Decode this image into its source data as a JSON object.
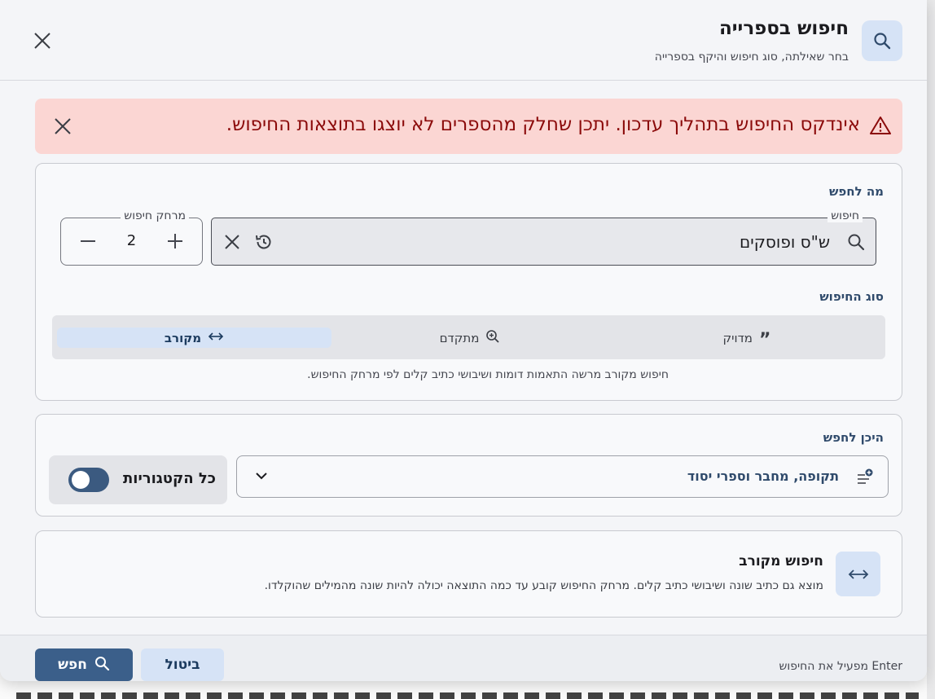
{
  "dialog": {
    "title": "חיפוש בספרייה",
    "subtitle": "בחר שאילתה, סוג חיפוש והיקף בספרייה"
  },
  "alert": {
    "text": "אינדקס החיפוש בתהליך עדכון. יתכן שחלק מהספרים לא יוצגו בתוצאות החיפוש."
  },
  "what": {
    "section_title": "מה לחפש",
    "search_label": "חיפוש",
    "search_value": "ש\"ס ופוסקים",
    "distance_label": "מרחק חיפוש",
    "distance_value": "2"
  },
  "search_type": {
    "section_title": "סוג החיפוש",
    "options": [
      {
        "label": "מדויק",
        "icon": "quote-icon"
      },
      {
        "label": "מתקדם",
        "icon": "zoom-in-icon"
      },
      {
        "label": "מקורב",
        "icon": "arrows-horizontal-icon",
        "selected": true
      }
    ],
    "note": "חיפוש מקורב מרשה התאמות דומות ושיבושי כתיב קלים לפי מרחק החיפוש."
  },
  "where": {
    "section_title": "היכן לחפש",
    "scope_label": "תקופה, מחבר וספרי יסוד",
    "categories_label": "כל הקטגוריות",
    "categories_toggle": false
  },
  "mode_info": {
    "title": "חיפוש מקורב",
    "description": "מוצא גם כתיב שונה ושיבושי כתיב קלים. מרחק החיפוש קובע עד כמה התוצאה יכולה להיות שונה מהמילים שהוקלדו."
  },
  "footer": {
    "hint": "Enter מפעיל את החיפוש",
    "cancel_label": "ביטול",
    "search_label": "חפש"
  },
  "colors": {
    "accent": "#3b5f8a",
    "accent_light": "#d6e3f6",
    "alert_bg": "#fbd6d3",
    "alert_text": "#8b0a0a"
  }
}
